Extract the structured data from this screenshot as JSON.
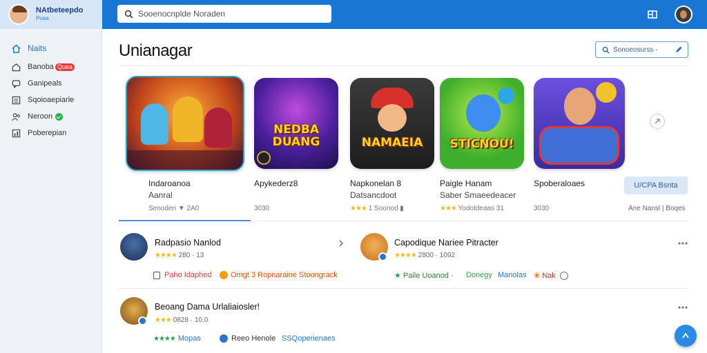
{
  "header": {
    "brand_title": "NAtbeteepdo",
    "brand_subtitle": "Poaa",
    "search_placeholder": "Sooenocnplde Noraden",
    "search_value": ""
  },
  "sidebar": {
    "items": [
      {
        "label": "Naits",
        "icon": "home-icon"
      },
      {
        "label": "Banoba",
        "badge": "Quea",
        "icon": "house-icon"
      },
      {
        "label": "Ganipeals",
        "icon": "chat-icon"
      },
      {
        "label": "Sqoioaepiarle",
        "icon": "list-icon"
      },
      {
        "label": "Neroon",
        "icon": "people-icon"
      },
      {
        "label": "Poberepian",
        "icon": "chart-icon"
      }
    ]
  },
  "main": {
    "title": "Unianagar",
    "sort_button": "Sonoeosurss -",
    "get_button": "U/CPA Bsnta",
    "cards": [
      {
        "name": "Indaroanoa",
        "name2": "Aanral",
        "meta_label": "Senoden",
        "meta_value": "2A0",
        "tile_text": ""
      },
      {
        "name": "Apykederz8",
        "name2": "",
        "meta_label": "3030",
        "meta_value": "",
        "tile_text": "NEDBA DUANG"
      },
      {
        "name": "Napkonelan 8",
        "name2": "Datsancdoot",
        "meta_label": "1 Soonod",
        "meta_value": "",
        "tile_text": "NAMAEIA"
      },
      {
        "name": "Paigle Hanam",
        "name2": "Saber Smaeedeacer",
        "meta_label": "Yodotdeaas",
        "meta_value": "31",
        "tile_text": "STICNOU!"
      },
      {
        "name": "Spoberaloaes",
        "name2": "",
        "meta_label": "3030",
        "meta_value": "",
        "tile_text": ""
      }
    ],
    "right_meta": "Ane Nansl | Boqes",
    "entries": [
      {
        "title": "Radpasio Nanlod",
        "meta": "280 · 13",
        "tags": [
          "Paho Idaphed",
          "Omgt 3 Ropnaraine Stoongrack"
        ]
      },
      {
        "title": "Capodique Nariee Pitracter",
        "meta": "2800 · 1092",
        "tags": [
          "Paile Uoanod ·",
          "Donegy",
          "Manolas",
          "Nak"
        ]
      },
      {
        "title": "Beoang Dama Urlaliaiosler!",
        "meta": "0828 · 10.0",
        "tags": [
          "Mopas",
          "Reeo Henole",
          "SSQoperienaes"
        ]
      }
    ]
  },
  "colors": {
    "topbar": "#1976d2",
    "accent": "#1976d2",
    "star": "#f5b81c",
    "tag_red": "#e53935",
    "tag_orange": "#f39c12",
    "tag_green": "#2e9e4d",
    "tag_blue": "#2a75c9"
  }
}
